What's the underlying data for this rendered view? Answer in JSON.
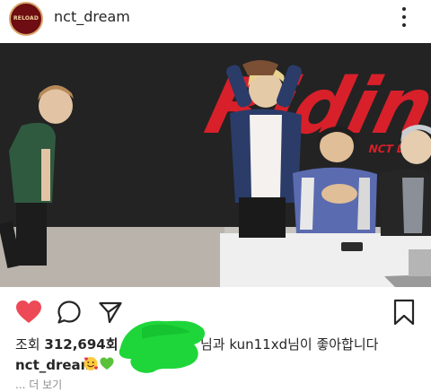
{
  "header": {
    "username": "nct_dream",
    "avatar_text": "RELOAD",
    "more_icon": "more-vertical-icon"
  },
  "post": {
    "photo_sign_text": "Ridin",
    "photo_sign_sub": "NCT DREAM"
  },
  "actions": {
    "like_icon": "heart-filled-icon",
    "comment_icon": "comment-icon",
    "share_icon": "send-icon",
    "save_icon": "bookmark-icon",
    "like_color": "#ed4956"
  },
  "stats": {
    "views_label": "조회",
    "views_count": "312,694회",
    "liked_text": "님과 kun11xd님이 좋아합니다"
  },
  "caption": {
    "username": "nct_dream",
    "emojis": [
      "smiling-face-with-hearts-emoji",
      "green-heart-emoji"
    ]
  },
  "more_label": "... 더 보기",
  "colors": {
    "sign_red": "#d8202a",
    "scribble_green": "#1fd63a"
  }
}
